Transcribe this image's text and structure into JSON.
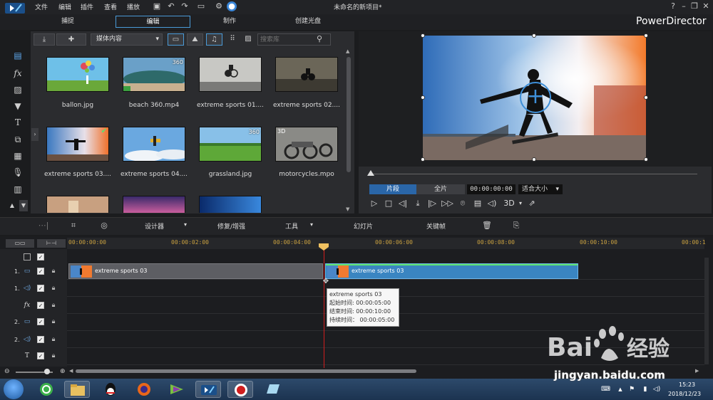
{
  "titlebar": {
    "menu": [
      "文件",
      "编辑",
      "插件",
      "查看",
      "播放"
    ],
    "window_title": "未命名的新项目*",
    "brand": "PowerDirector",
    "help": "?"
  },
  "mode_tabs": [
    "捕捉",
    "编辑",
    "制作",
    "创建光盘"
  ],
  "library": {
    "media_select": "媒体内容",
    "search_placeholder": "搜索库",
    "items": [
      {
        "name": "ballon.jpg",
        "badge": ""
      },
      {
        "name": "beach 360.mp4",
        "badge": "360"
      },
      {
        "name": "extreme sports 01....",
        "badge": ""
      },
      {
        "name": "extreme sports 02....",
        "badge": ""
      },
      {
        "name": "extreme sports 03....",
        "badge": ""
      },
      {
        "name": "extreme sports 04....",
        "badge": ""
      },
      {
        "name": "grassland.jpg",
        "badge": "360"
      },
      {
        "name": "motorcycles.mpo",
        "badge": "3D"
      }
    ]
  },
  "preview": {
    "clip_label": "片段",
    "full_label": "全片",
    "timecode": "00:00:00:00",
    "fit_select": "适合大小",
    "mode_3d": "3D"
  },
  "edit_toolbar": {
    "designer": "设计器",
    "fix_enhance": "修复/增强",
    "tools": "工具",
    "slideshow": "幻灯片",
    "keyframe": "关键帧"
  },
  "timeline": {
    "ruler": [
      "00:00:00:00",
      "00:00:02:00",
      "00:00:04:00",
      "00:00:06:00",
      "00:00:08:00",
      "00:00:10:00",
      "00:00:1"
    ],
    "tracks": [
      {
        "num": "1.",
        "kind": "video"
      },
      {
        "num": "1.",
        "kind": "audio"
      },
      {
        "num": "",
        "kind": "fx"
      },
      {
        "num": "2.",
        "kind": "video"
      },
      {
        "num": "2.",
        "kind": "audio"
      },
      {
        "num": "",
        "kind": "title"
      }
    ],
    "clip1_name": "extreme sports 03",
    "clip2_name": "extreme sports 03",
    "tooltip": {
      "title": "extreme sports 03",
      "start": "起始时间: 00:00:05:00",
      "end": "结束时间: 00:00:10:00",
      "duration": "持续时间：  00:00:05:00"
    }
  },
  "taskbar": {
    "time": "15:23",
    "date": "2018/12/23"
  },
  "watermark": {
    "site": "jingyan.baidu.com"
  }
}
